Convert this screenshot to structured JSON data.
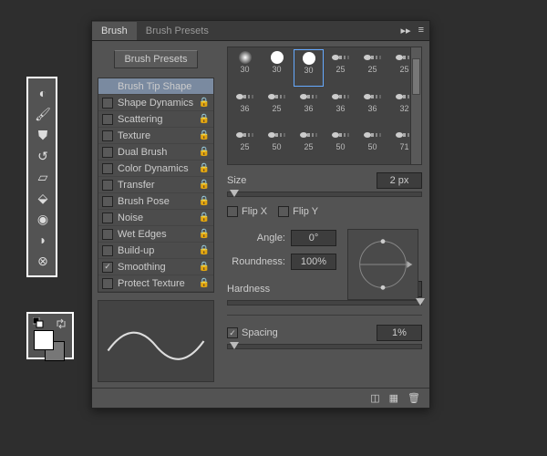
{
  "tabs": {
    "brush": "Brush",
    "presets": "Brush Presets"
  },
  "btn_presets": "Brush Presets",
  "options": [
    {
      "label": "Brush Tip Shape",
      "checkbox": false,
      "lock": false,
      "selected": true
    },
    {
      "label": "Shape Dynamics",
      "checkbox": true,
      "checked": false,
      "lock": true
    },
    {
      "label": "Scattering",
      "checkbox": true,
      "checked": false,
      "lock": true
    },
    {
      "label": "Texture",
      "checkbox": true,
      "checked": false,
      "lock": true
    },
    {
      "label": "Dual Brush",
      "checkbox": true,
      "checked": false,
      "lock": true
    },
    {
      "label": "Color Dynamics",
      "checkbox": true,
      "checked": false,
      "lock": true
    },
    {
      "label": "Transfer",
      "checkbox": true,
      "checked": false,
      "lock": true
    },
    {
      "label": "Brush Pose",
      "checkbox": true,
      "checked": false,
      "lock": true
    },
    {
      "label": "Noise",
      "checkbox": true,
      "checked": false,
      "lock": true
    },
    {
      "label": "Wet Edges",
      "checkbox": true,
      "checked": false,
      "lock": true
    },
    {
      "label": "Build-up",
      "checkbox": true,
      "checked": false,
      "lock": true
    },
    {
      "label": "Smoothing",
      "checkbox": true,
      "checked": true,
      "lock": true
    },
    {
      "label": "Protect Texture",
      "checkbox": true,
      "checked": false,
      "lock": true
    }
  ],
  "preset_rows": [
    [
      {
        "t": "soft",
        "v": "30"
      },
      {
        "t": "hard",
        "v": "30"
      },
      {
        "t": "hard",
        "v": "30",
        "sel": true
      },
      {
        "t": "dash",
        "v": "25"
      },
      {
        "t": "dash",
        "v": "25"
      },
      {
        "t": "dash",
        "v": "25"
      }
    ],
    [
      {
        "t": "dash",
        "v": "36"
      },
      {
        "t": "dash",
        "v": "25"
      },
      {
        "t": "dash",
        "v": "36"
      },
      {
        "t": "dash",
        "v": "36"
      },
      {
        "t": "dash",
        "v": "36"
      },
      {
        "t": "dash",
        "v": "32"
      }
    ],
    [
      {
        "t": "dash",
        "v": "25"
      },
      {
        "t": "dash",
        "v": "50"
      },
      {
        "t": "dash",
        "v": "25"
      },
      {
        "t": "dash",
        "v": "50"
      },
      {
        "t": "dash",
        "v": "50"
      },
      {
        "t": "dash",
        "v": "71"
      }
    ]
  ],
  "size_label": "Size",
  "size_value": "2 px",
  "flipx": "Flip X",
  "flipy": "Flip Y",
  "angle_label": "Angle:",
  "angle_value": "0°",
  "round_label": "Roundness:",
  "round_value": "100%",
  "hard_label": "Hardness",
  "hard_value": "100%",
  "spacing_label": "Spacing",
  "spacing_value": "1%",
  "tools": [
    "heal",
    "brush",
    "stamp",
    "history",
    "eraser",
    "bucket",
    "blur",
    "dodge",
    "sponge"
  ]
}
